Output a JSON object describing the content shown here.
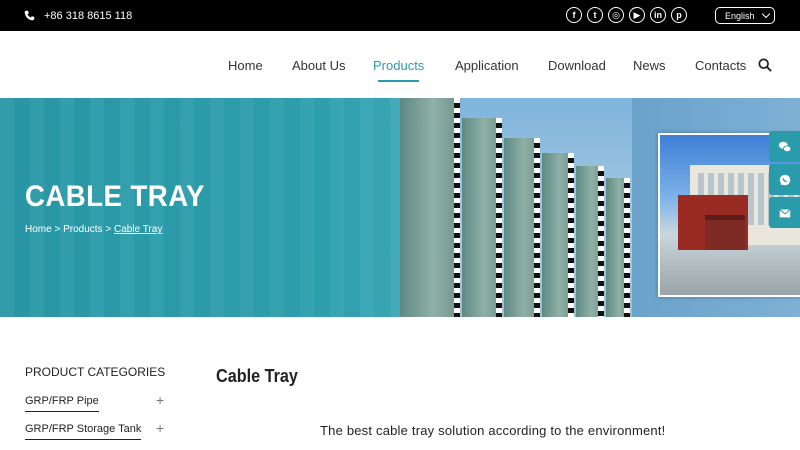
{
  "topbar": {
    "phone": "+86 318 8615 118",
    "socials": [
      {
        "icon": "facebook-icon",
        "glyph": "f"
      },
      {
        "icon": "twitter-icon",
        "glyph": "t"
      },
      {
        "icon": "instagram-icon",
        "glyph": "◎"
      },
      {
        "icon": "youtube-icon",
        "glyph": "▶"
      },
      {
        "icon": "linkedin-icon",
        "glyph": "in"
      },
      {
        "icon": "pinterest-icon",
        "glyph": "p"
      }
    ],
    "language": "English"
  },
  "nav": {
    "items": [
      "Home",
      "About Us",
      "Products",
      "Application",
      "Download",
      "News",
      "Contacts"
    ],
    "active": "Products"
  },
  "banner": {
    "title": "CABLE TRAY",
    "breadcrumb": {
      "home": "Home",
      "sep1": " > ",
      "products": "Products",
      "sep2": " > ",
      "current": "Cable Tray"
    }
  },
  "side_contacts": [
    "wechat-icon",
    "whatsapp-icon",
    "email-icon"
  ],
  "sidebar": {
    "title": "PRODUCT CATEGORIES",
    "items": [
      {
        "label": "GRP/FRP Pipe",
        "expand": "+"
      },
      {
        "label": "GRP/FRP Storage Tank",
        "expand": "+"
      }
    ]
  },
  "main": {
    "title": "Cable Tray",
    "tagline": "The best cable tray solution according to the environment!"
  },
  "colors": {
    "accent": "#2a9bab",
    "topbar": "#000000"
  }
}
